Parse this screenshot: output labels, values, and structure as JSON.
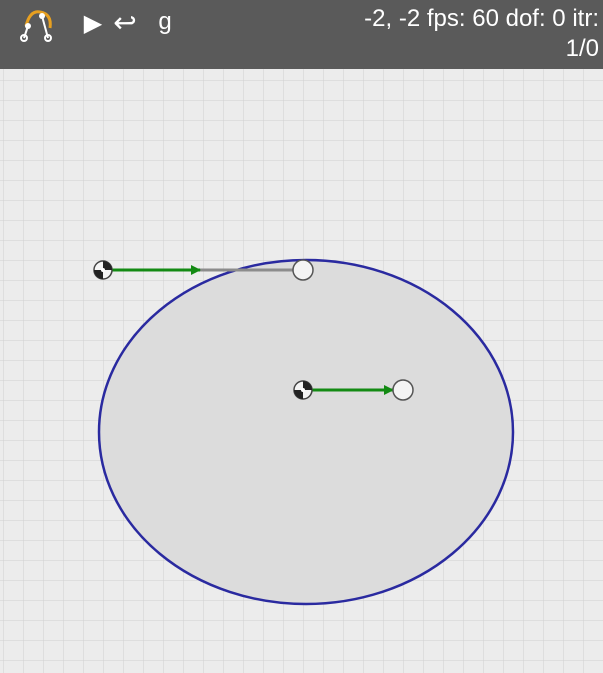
{
  "toolbar": {
    "logo_icon": "mec2-logo-icon",
    "run_icon": "play-icon",
    "run_glyph": "▶",
    "reset_icon": "undo-arrow-icon",
    "reset_glyph": "↩",
    "grid_label": "g"
  },
  "status": {
    "pointer": "-2, -2",
    "fps_label": "fps:",
    "fps": "60",
    "dof_label": "dof:",
    "dof": "0",
    "itr_label": "itr:",
    "itr": "1/0"
  },
  "colors": {
    "toolbar_bg": "#5a5a5a",
    "canvas_bg": "#ececec",
    "grid_line": "#d0d0d0",
    "ellipse_fill": "#dcdcdc",
    "ellipse_stroke": "#2a2aa0",
    "vector": "#138a13",
    "link": "#8c8c8c",
    "node_fill": "#f4f4f4",
    "node_stroke": "#444444"
  },
  "scene": {
    "grid": true,
    "elements": [
      "ellipse",
      "vector-top",
      "link-top",
      "vector-center",
      "base-node-top",
      "base-node-center",
      "node-top",
      "node-right"
    ]
  }
}
